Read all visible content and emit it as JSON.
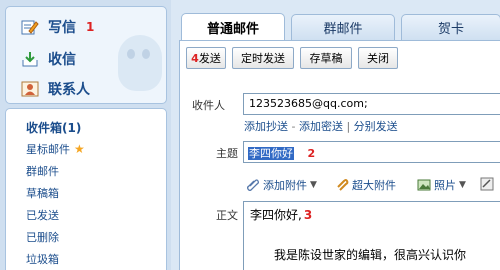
{
  "sidebar": {
    "compose": {
      "label": "写信",
      "badge": "1"
    },
    "inbox_nav": {
      "label": "收信"
    },
    "contacts": {
      "label": "联系人"
    },
    "folders_title": "收件箱(1)",
    "folders": [
      "星标邮件",
      "群邮件",
      "草稿箱",
      "已发送",
      "已删除",
      "垃圾箱"
    ]
  },
  "tabs": [
    "普通邮件",
    "群邮件",
    "贺卡"
  ],
  "toolbar": {
    "send_step": "4",
    "send": "发送",
    "scheduled": "定时发送",
    "draft": "存草稿",
    "close": "关闭"
  },
  "form": {
    "to_label": "收件人",
    "to_value": "123523685@qq.com;",
    "add_cc": "添加抄送",
    "add_bcc": "添加密送",
    "separate": "分别发送",
    "subject_label": "主题",
    "subject_value": "李四你好",
    "subject_step": "2",
    "attach": "添加附件",
    "big_attach": "超大附件",
    "photo": "照片",
    "body_label": "正文",
    "body_line1": "李四你好,",
    "body_step": "3",
    "body_line2": "我是陈设世家的编辑，很高兴认识你"
  },
  "colors": {
    "accent": "#1b4d8c",
    "step_red": "#d22",
    "selection": "#316ac5"
  }
}
